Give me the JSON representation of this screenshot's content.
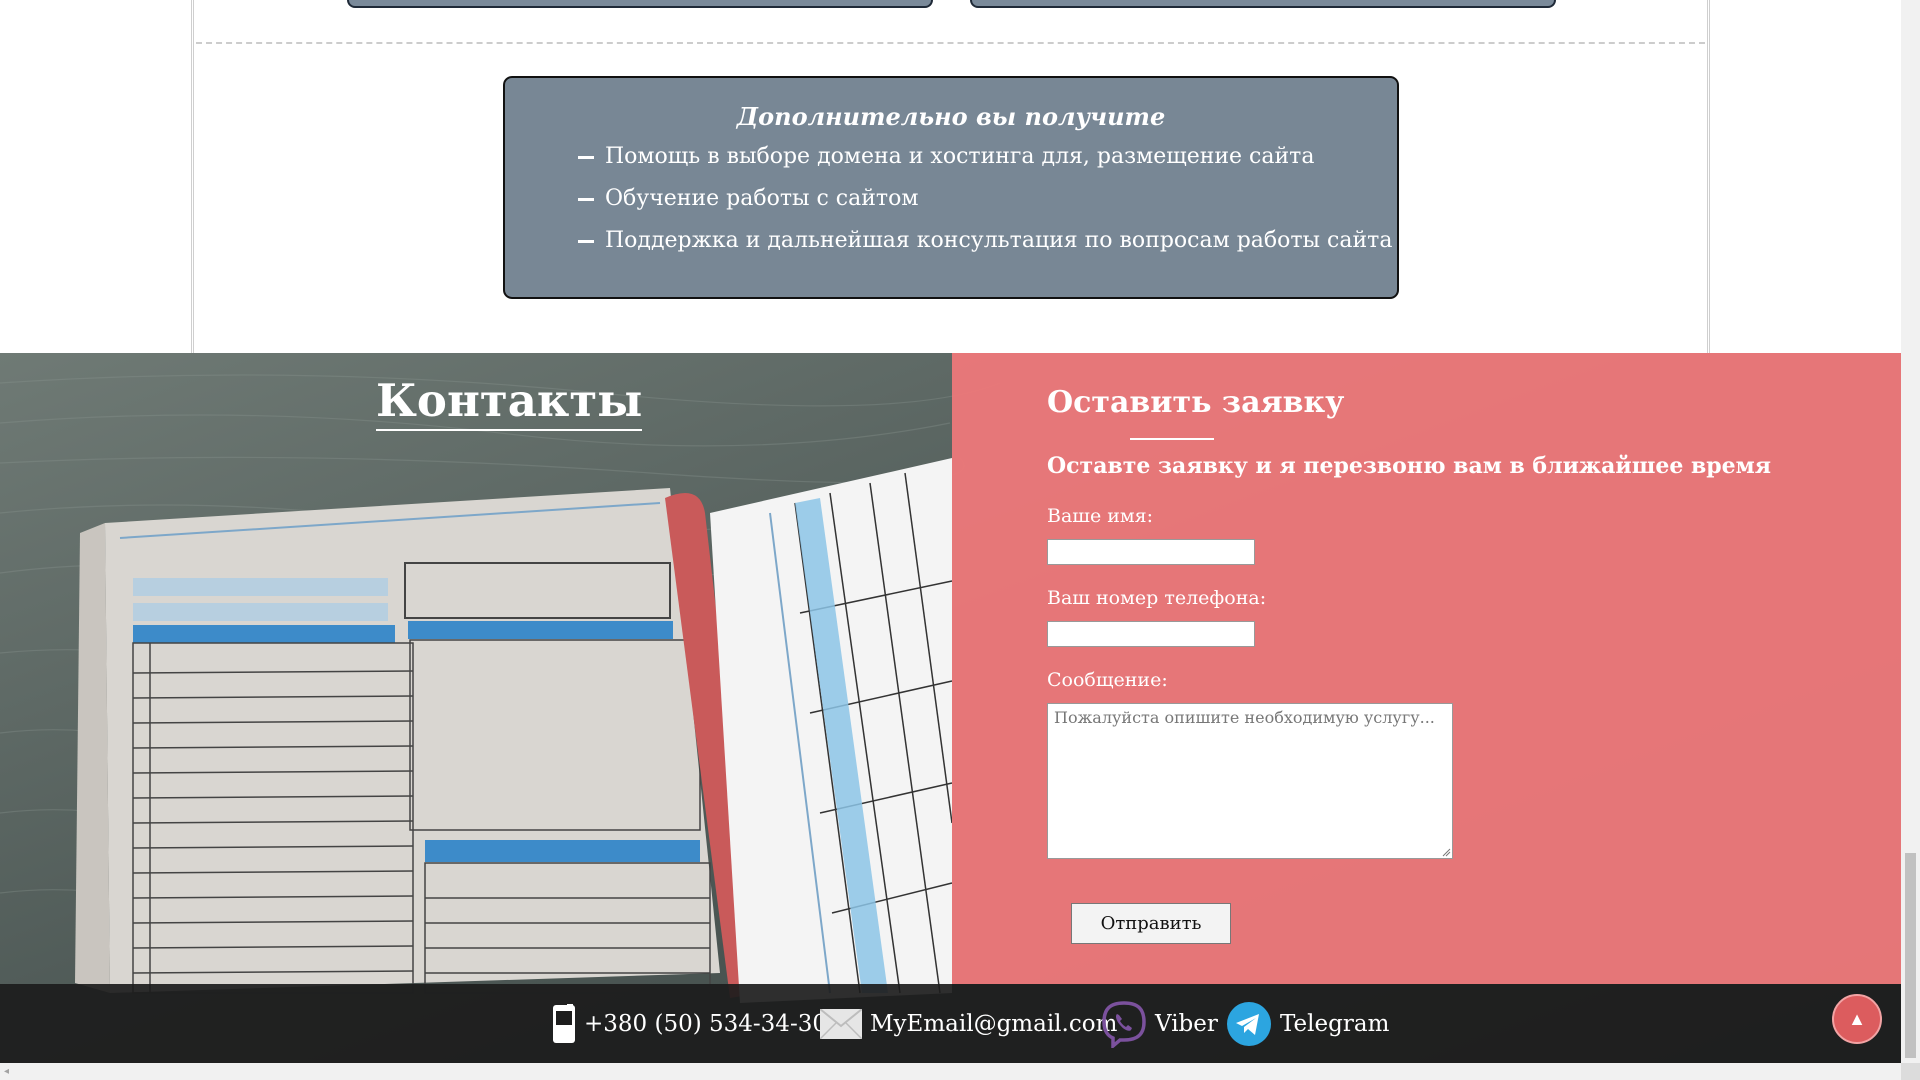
{
  "extra": {
    "title": "Дополнительно вы получите",
    "items": [
      "Помощь в выборе домена и хостинга для, размещение сайта",
      "Обучение работы с сайтом",
      "Поддержка и дальнейшая консультация по вопросам работы сайта"
    ]
  },
  "contacts": {
    "title": "Контакты"
  },
  "form": {
    "title": "Оставить заявку",
    "subtitle": "Оставте заявку и я перезвоню вам в ближайшее время",
    "name_label": "Ваше имя:",
    "name_value": "",
    "phone_label": "Ваш номер телефона:",
    "phone_value": "",
    "message_label": "Сообщение:",
    "message_placeholder": "Пожалуйста опишите необходимую услугу...",
    "submit_label": "Отправить"
  },
  "footer": {
    "phone": "+380 (50) 534-34-30",
    "email": "MyEmail@gmail.com",
    "viber": "Viber",
    "telegram": "Telegram"
  },
  "scroll_top": {
    "icon": "triangle-up-icon",
    "glyph": "▲"
  },
  "colors": {
    "info_box": "#788795",
    "form_panel": "#ec787a",
    "footer": "#1c1c1c",
    "scroll_top": "#dc5c5e",
    "viber": "#7b519d",
    "telegram": "#2ca5e0"
  },
  "icons": [
    "mobile-phone-icon",
    "envelope-icon",
    "viber-icon",
    "telegram-icon",
    "triangle-up-icon"
  ]
}
